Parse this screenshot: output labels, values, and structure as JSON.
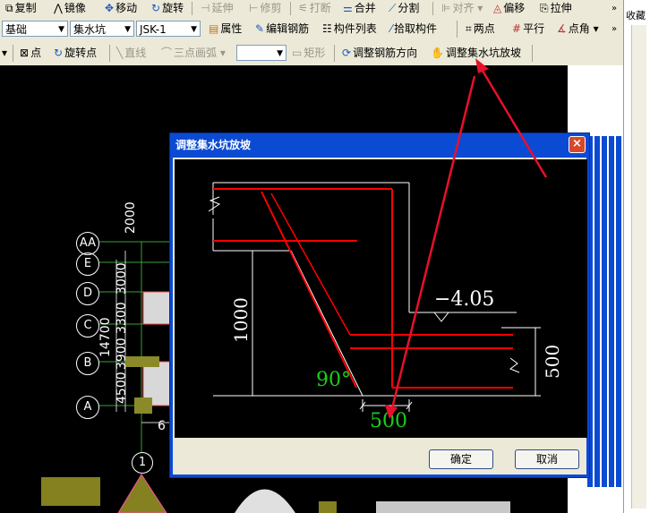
{
  "toolbar1": {
    "copy": "复制",
    "mirror": "镜像",
    "move": "移动",
    "rotate": "旋转",
    "extend": "延伸",
    "trim": "修剪",
    "break": "打断",
    "merge": "合并",
    "split": "分割",
    "align": "对齐",
    "offset": "偏移",
    "stretch": "拉伸"
  },
  "toolbar2": {
    "floor_select": "基础",
    "type_select": "集水坑",
    "component_select": "JSK-1",
    "properties": "属性",
    "edit_rebar": "编辑钢筋",
    "component_list": "构件列表",
    "pick_component": "拾取构件",
    "two_points": "两点",
    "parallel": "平行",
    "point_angle": "点角"
  },
  "toolbar3": {
    "point": "点",
    "rotate_point": "旋转点",
    "line": "直线",
    "arc3": "三点画弧",
    "rect": "矩形",
    "rebar_dir": "调整钢筋方向",
    "slope_adjust": "调整集水坑放坡"
  },
  "right_strip": {
    "fav_label": "收藏"
  },
  "axes": {
    "rows": [
      "AA",
      "E",
      "D",
      "C",
      "B",
      "A"
    ],
    "col": "1",
    "dims": [
      "2000",
      "3000",
      "3300",
      "3900",
      "14700",
      "4500"
    ],
    "bottom_dim": "6"
  },
  "dialog": {
    "title": "调整集水坑放坡",
    "close": "×",
    "ok": "确定",
    "cancel": "取消",
    "figure": {
      "elev": "−4.05",
      "dim_height": "1000",
      "dim_right": "500",
      "dim_bottom": "500",
      "angle": "90°"
    }
  },
  "colors": {
    "rebar": "#ff0000",
    "edit_value": "#19d019",
    "arrow": "#e8102a",
    "dialog_title": "#0b4ad3"
  }
}
